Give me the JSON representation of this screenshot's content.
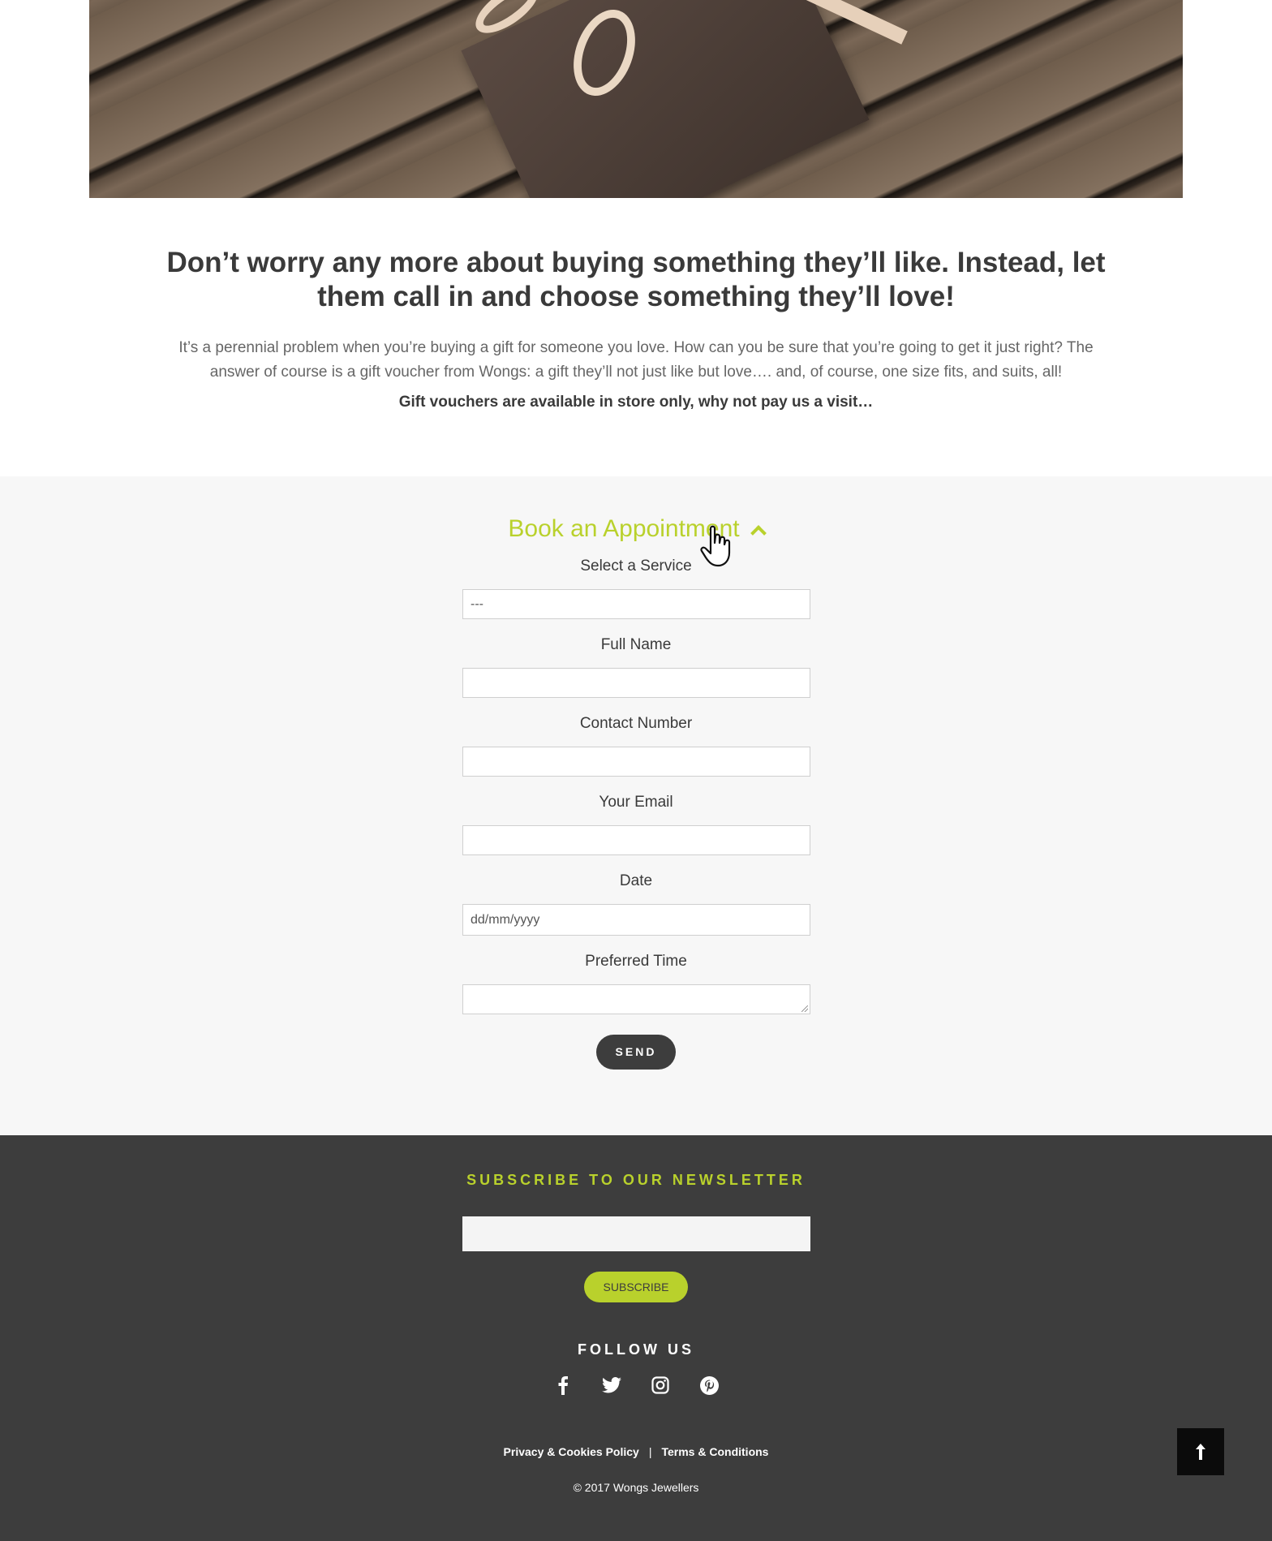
{
  "intro": {
    "heading_line1": "Don’t worry any more about buying something they’ll like. Instead, let",
    "heading_line2": "them call in and choose something they’ll love!",
    "body": "It’s a perennial problem when you’re buying a gift for someone you love. How can you be sure that you’re going to get it just right? The answer of course is a gift voucher from Wongs: a gift they’ll not just like but love…. and, of course, one size fits, and suits, all!",
    "bold": "Gift vouchers are available in store only, why not pay us a visit…"
  },
  "appointment": {
    "title": "Book an Appointment",
    "service_label": "Select a Service",
    "service_value": "---",
    "name_label": "Full Name",
    "name_value": "",
    "contact_label": "Contact Number",
    "contact_value": "",
    "email_label": "Your Email",
    "email_value": "",
    "date_label": "Date",
    "date_placeholder": "dd/mm/yyyy",
    "time_label": "Preferred Time",
    "time_value": "",
    "send_label": "SEND"
  },
  "footer": {
    "newsletter_title": "SUBSCRIBE TO OUR NEWSLETTER",
    "subscribe_label": "SUBSCRIBE",
    "follow_title": "FOLLOW US",
    "social_icons": [
      "facebook-icon",
      "twitter-icon",
      "instagram-icon",
      "pinterest-icon"
    ],
    "privacy_link": "Privacy & Cookies Policy",
    "separator": "|",
    "terms_link": "Terms & Conditions",
    "copyright": "© 2017 Wongs Jewellers"
  },
  "colors": {
    "accent": "#b9d12c",
    "footer_bg": "#3d3d3d",
    "section_bg": "#f7f7f7"
  }
}
